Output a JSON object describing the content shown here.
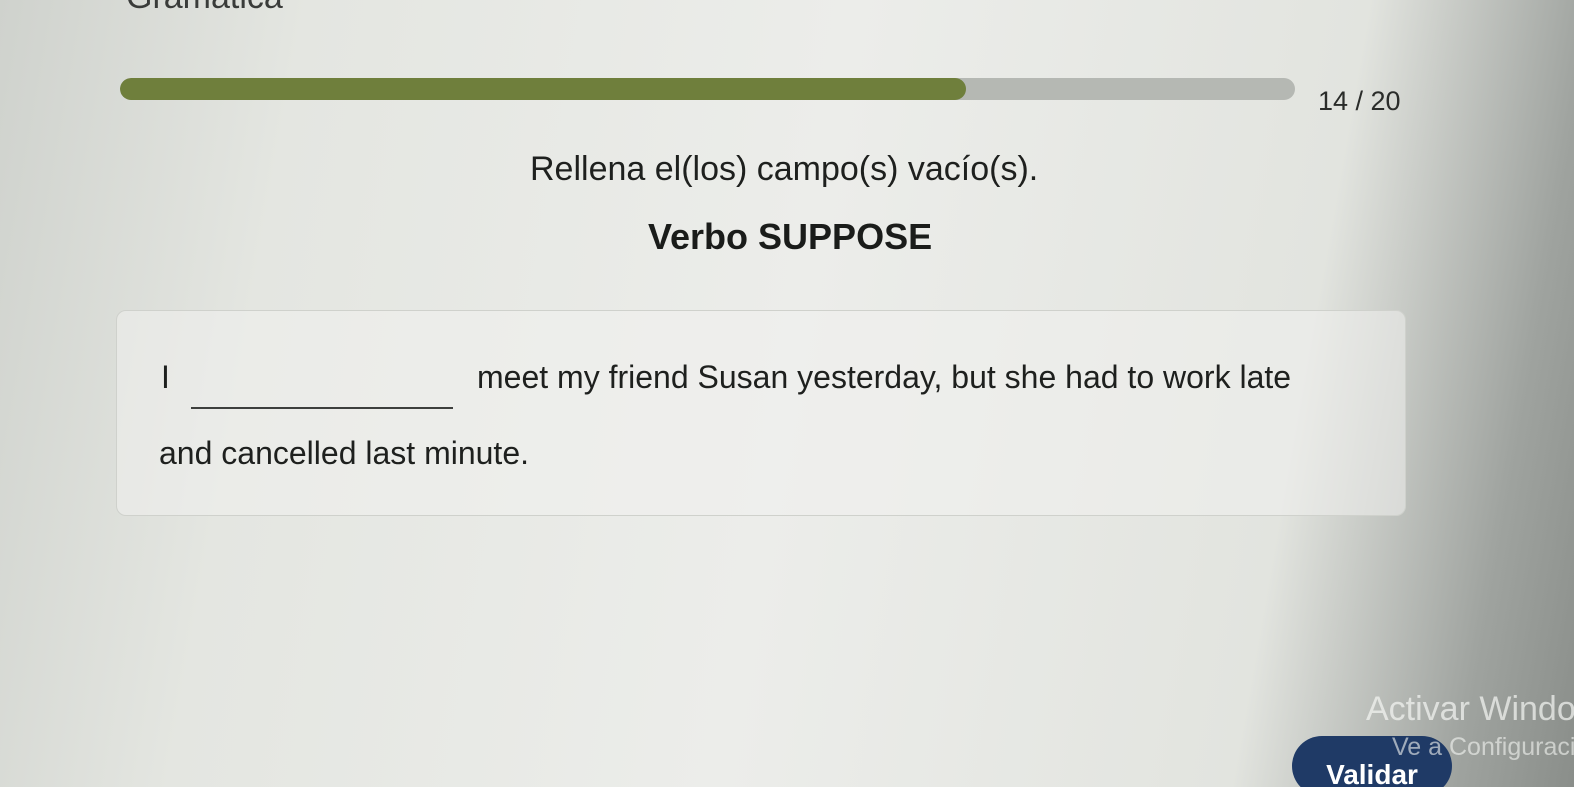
{
  "header": {
    "title": "Gramática"
  },
  "progress": {
    "current": 14,
    "total": 20,
    "fraction": 0.72,
    "label": "14 / 20",
    "fill_color": "#6f7f3c",
    "track_color": "#b5b8b3"
  },
  "exercise": {
    "instruction": "Rellena el(los) campo(s) vacío(s).",
    "verb_heading": "Verbo SUPPOSE",
    "sentence_subject": "I",
    "blank_value": "",
    "sentence_rest": "meet my friend Susan yesterday, but she had to work late",
    "sentence_end": "and cancelled last minute."
  },
  "actions": {
    "validate_label": "Validar",
    "validate_color": "#1f3a66"
  },
  "watermark": {
    "main": "Activar Windo",
    "sub": "Ve a Configuración"
  }
}
